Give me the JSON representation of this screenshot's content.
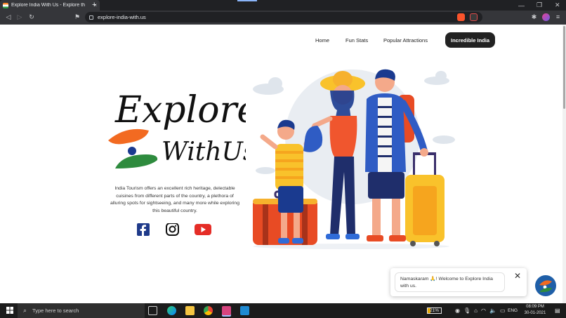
{
  "browser": {
    "tab_title": "Explore India With Us - Explore th",
    "new_tab": "+",
    "url": "explore-india-with.us",
    "win_minimize": "—",
    "win_maximize": "❐",
    "win_close": "✕",
    "tab_close": "×"
  },
  "nav": {
    "items": [
      "Home",
      "Fun Stats",
      "Popular Attractions"
    ],
    "highlight": "Incredible India"
  },
  "hero": {
    "logo_line1": "Explore",
    "logo_line2": "WithUs",
    "description": "India Tourism offers an excellent rich heritage, delectable cuisines from different parts of the country, a plethora of alluring spots for sightseeing, and many more while exploring this beautiful country."
  },
  "social": {
    "icons": [
      "facebook-icon",
      "instagram-icon",
      "youtube-icon"
    ],
    "colors": {
      "facebook": "#1f3a8a",
      "instagram": "#111111",
      "youtube": "#e52d27"
    }
  },
  "chat": {
    "message": "Namaskaram 🙏! Welcome to Explore India with us.",
    "close": "✕"
  },
  "taskbar": {
    "search_placeholder": "Type here to search",
    "battery": "21%",
    "language": "ENG",
    "time": "08:09 PM",
    "date": "30-01-2021"
  },
  "colors": {
    "saffron": "#f26a21",
    "green": "#2e8b3e",
    "navy": "#1a3a8f",
    "chrome_dark": "#202124",
    "chrome_mid": "#35363a"
  }
}
